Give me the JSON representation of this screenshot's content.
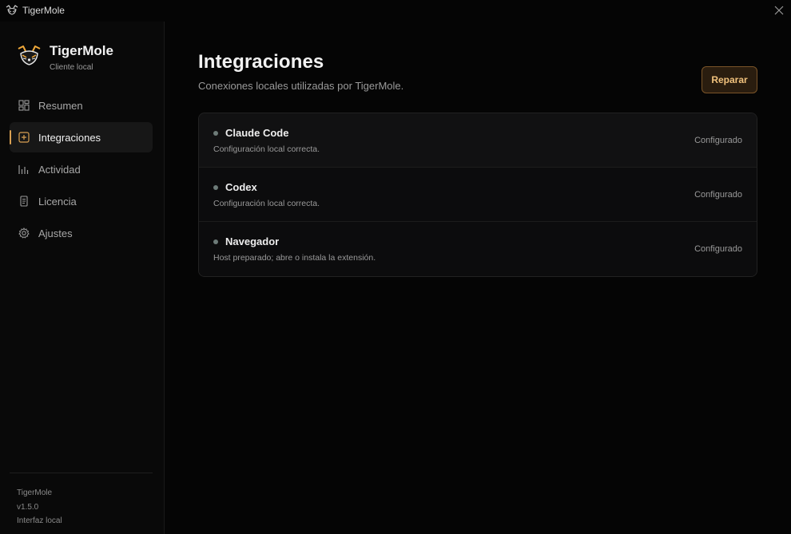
{
  "window": {
    "title": "TigerMole"
  },
  "sidebar": {
    "brand_name": "TigerMole",
    "brand_subtitle": "Cliente local",
    "items": [
      {
        "label": "Resumen",
        "icon": "dashboard-icon",
        "active": false
      },
      {
        "label": "Integraciones",
        "icon": "plus-square-icon",
        "active": true
      },
      {
        "label": "Actividad",
        "icon": "bar-chart-icon",
        "active": false
      },
      {
        "label": "Licencia",
        "icon": "document-icon",
        "active": false
      },
      {
        "label": "Ajustes",
        "icon": "gear-icon",
        "active": false
      }
    ],
    "footer": {
      "app": "TigerMole",
      "version": "v1.5.0",
      "mode": "Interfaz local"
    }
  },
  "main": {
    "title": "Integraciones",
    "subtitle": "Conexiones locales utilizadas por TigerMole.",
    "repair_label": "Reparar",
    "integrations": [
      {
        "name": "Claude Code",
        "description": "Configuración local correcta.",
        "status": "Configurado"
      },
      {
        "name": "Codex",
        "description": "Configuración local correcta.",
        "status": "Configurado"
      },
      {
        "name": "Navegador",
        "description": "Host preparado; abre o instala la extensión.",
        "status": "Configurado"
      }
    ]
  },
  "colors": {
    "accent": "#d8a052",
    "button_text": "#f1c27d",
    "status_dot": "#6d7b78"
  }
}
